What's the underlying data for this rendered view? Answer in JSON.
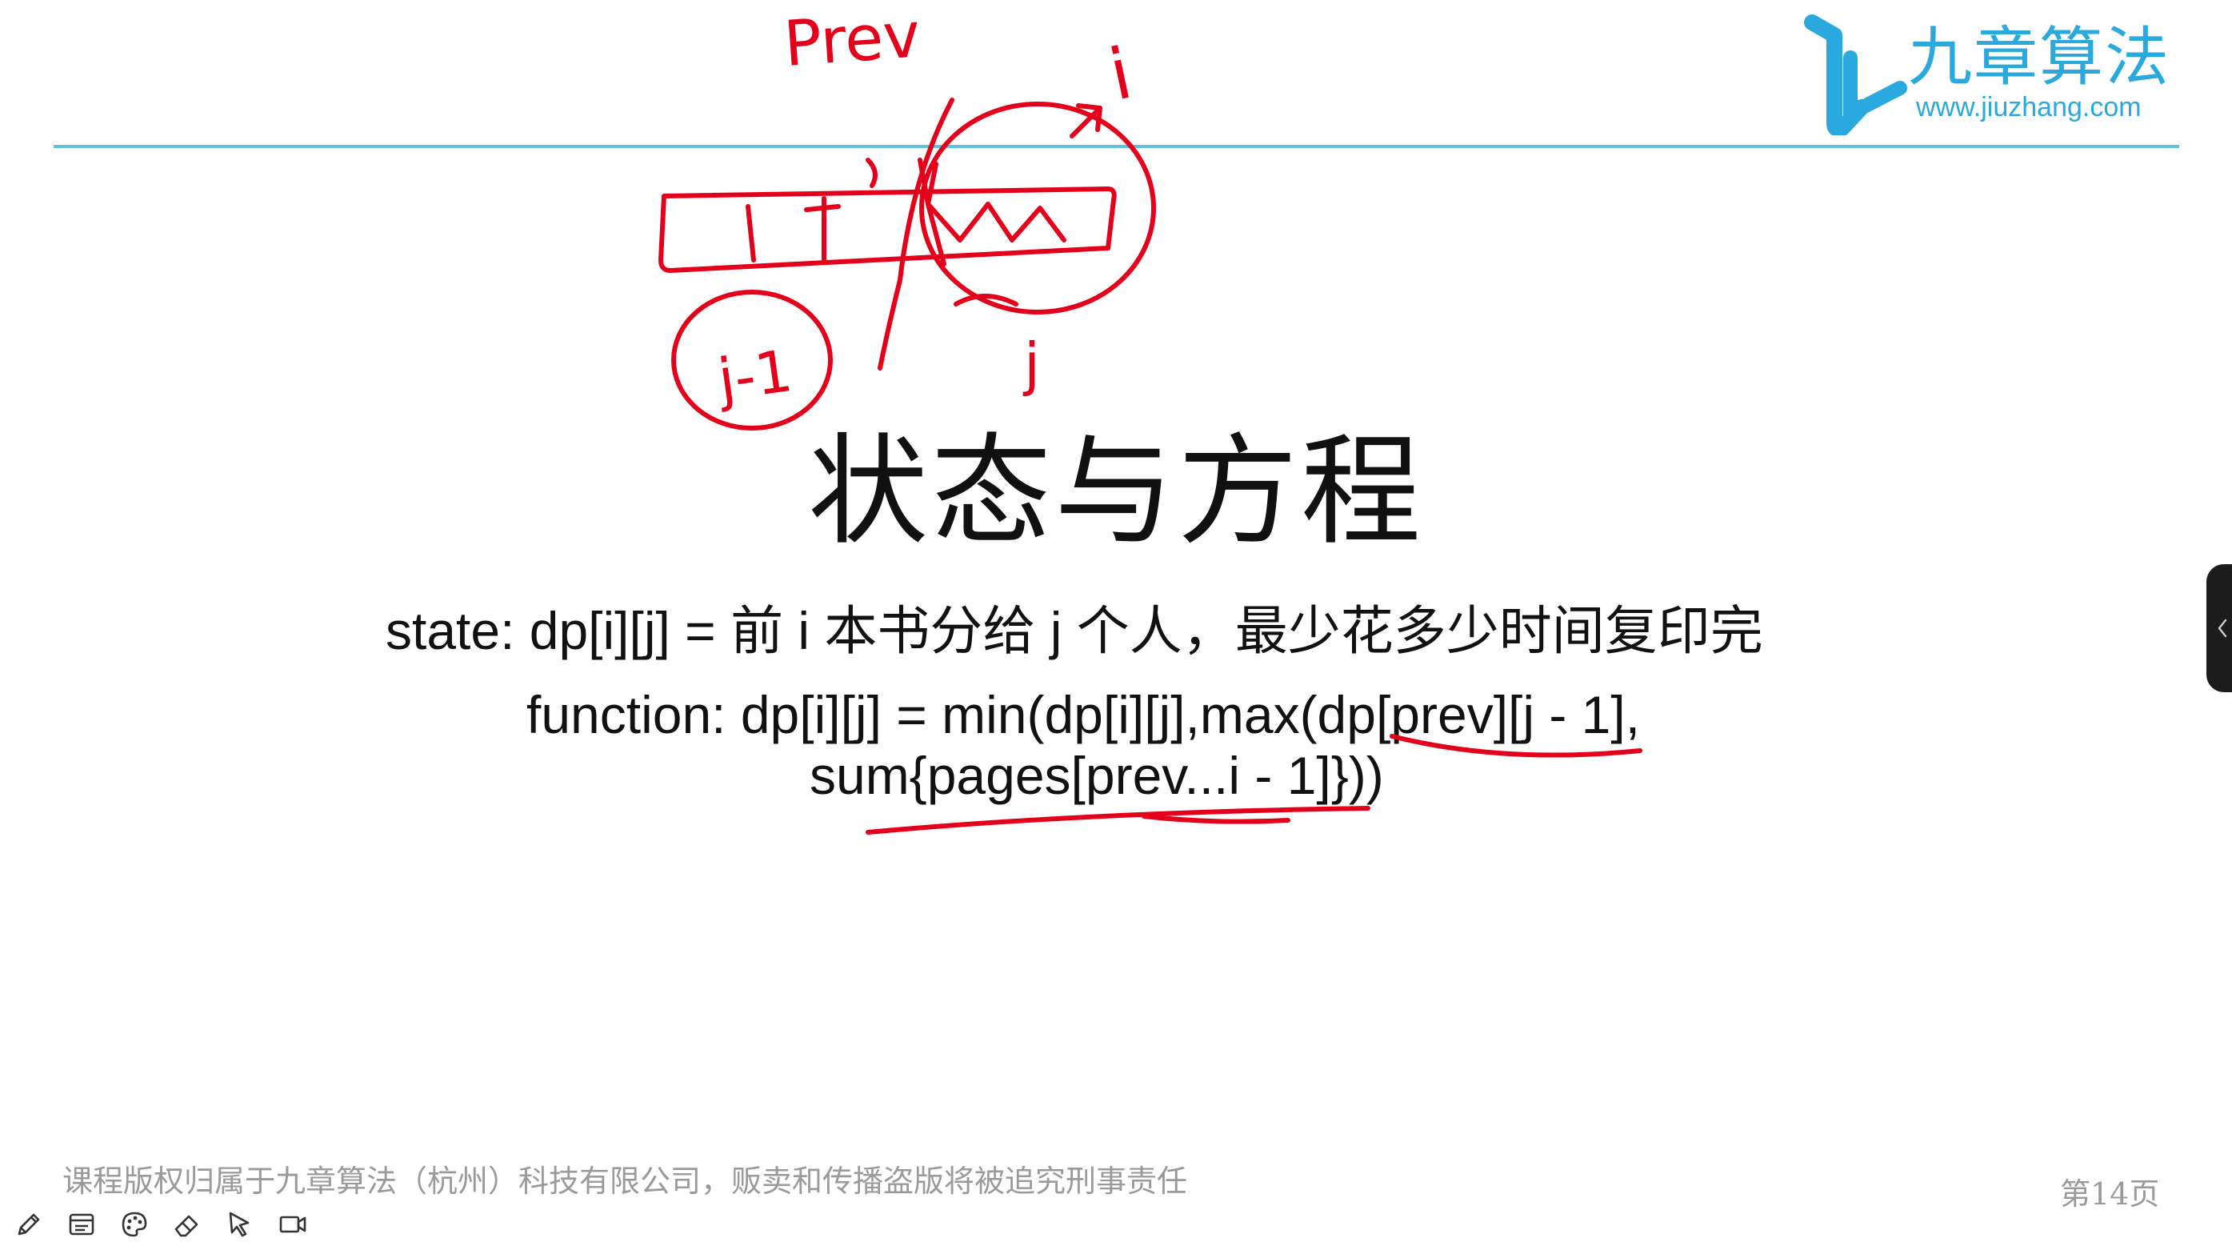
{
  "brand": {
    "name": "九章算法",
    "url": "www.jiuzhang.com",
    "color": "#29a9dd"
  },
  "slide": {
    "title": "状态与方程",
    "state_line": "state: dp[i][j] = 前 i 本书分给 j 个人，最少花多少时间复印完",
    "function_line_1": "function: dp[i][j] = min(dp[i][j],max(dp[prev][j - 1],",
    "function_line_2": "sum{pages[prev...i - 1]}))"
  },
  "annotations": {
    "color": "#e4001b",
    "labels": {
      "prev": "Prev",
      "i": "i",
      "j": "j",
      "j_minus_1": "j-1"
    }
  },
  "footer": {
    "copyright": "课程版权归属于九章算法（杭州）科技有限公司，贩卖和传播盗版将被追究刑事责任",
    "page_number": "第14页"
  },
  "toolbar": {
    "tools": [
      "pencil-icon",
      "whiteboard-icon",
      "palette-icon",
      "eraser-icon",
      "pointer-icon",
      "camera-icon"
    ]
  },
  "side_panel": {
    "icon": "chevron-left-icon"
  },
  "colors": {
    "header_rule": "#5bc2e0",
    "footer_text": "#9a9a9a"
  }
}
